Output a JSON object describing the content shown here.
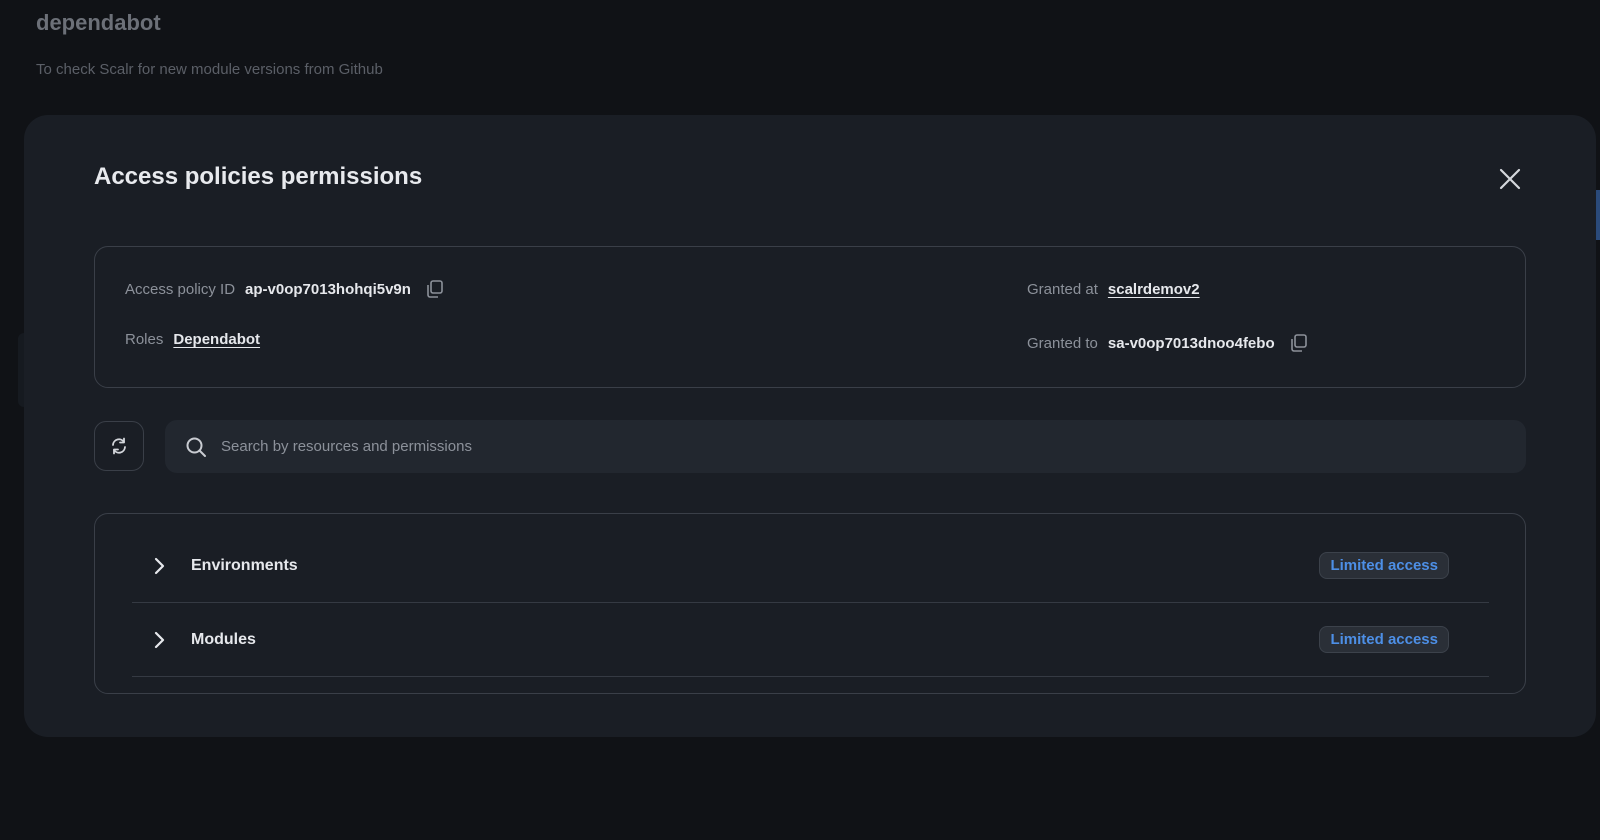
{
  "page": {
    "title": "dependabot",
    "subtitle": "To check Scalr for new module versions from Github"
  },
  "modal": {
    "title": "Access policies permissions",
    "info": {
      "policy_id_label": "Access policy ID",
      "policy_id_value": "ap-v0op7013hohqi5v9n",
      "roles_label": "Roles",
      "roles_value": "Dependabot",
      "granted_at_label": "Granted at",
      "granted_at_value": "scalrdemov2",
      "granted_to_label": "Granted to",
      "granted_to_value": "sa-v0op7013dnoo4febo"
    },
    "search": {
      "placeholder": "Search by resources and permissions"
    },
    "resources": [
      {
        "name": "Environments",
        "access": "Limited access"
      },
      {
        "name": "Modules",
        "access": "Limited access"
      }
    ]
  },
  "colors": {
    "background": "#101216",
    "modal": "#1a1e25",
    "accent": "#4d8fe6"
  },
  "icons": [
    "close-icon",
    "copy-icon",
    "refresh-icon",
    "search-icon",
    "chevron-right-icon"
  ]
}
